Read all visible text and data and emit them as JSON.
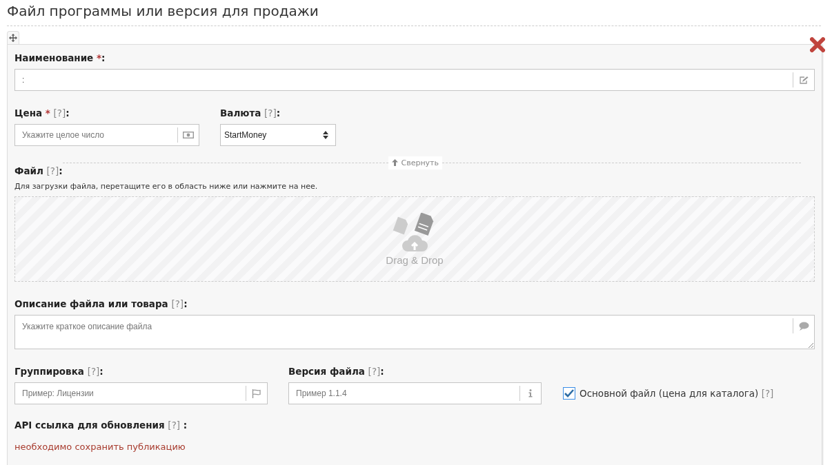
{
  "title": "Файл программы или версия для продажи",
  "name_field": {
    "label": "Наименование",
    "required": "*",
    "colon": ":",
    "value": ":"
  },
  "price_field": {
    "label": "Цена",
    "required": "*",
    "help": "[?]",
    "colon": ":",
    "placeholder": "Укажите целое число"
  },
  "currency_field": {
    "label": "Валюта",
    "help": "[?]",
    "colon": ":",
    "value": "StartMoney"
  },
  "collapse_button": "Свернуть",
  "file_field": {
    "label": "Файл",
    "help": "[?]",
    "colon": ":",
    "hint": "Для загрузки файла, перетащите его в область ниже или нажмите на нее.",
    "drop_text": "Drag & Drop"
  },
  "description_field": {
    "label": "Описание файла или товара",
    "help": "[?]",
    "colon": ":",
    "placeholder": "Укажите краткое описание файла"
  },
  "grouping_field": {
    "label": "Группировка",
    "help": "[?]",
    "colon": ":",
    "placeholder": "Пример: Лицензии"
  },
  "version_field": {
    "label": "Версия файла",
    "help": "[?]",
    "colon": ":",
    "placeholder": "Пример 1.1.4"
  },
  "main_file": {
    "label": "Основной файл (цена для каталога)",
    "help": "[?]",
    "checked": true
  },
  "api_field": {
    "label": "API ссылка для обновления",
    "help": "[?]",
    "colon": " :",
    "value": "необходимо сохранить публикацию"
  }
}
